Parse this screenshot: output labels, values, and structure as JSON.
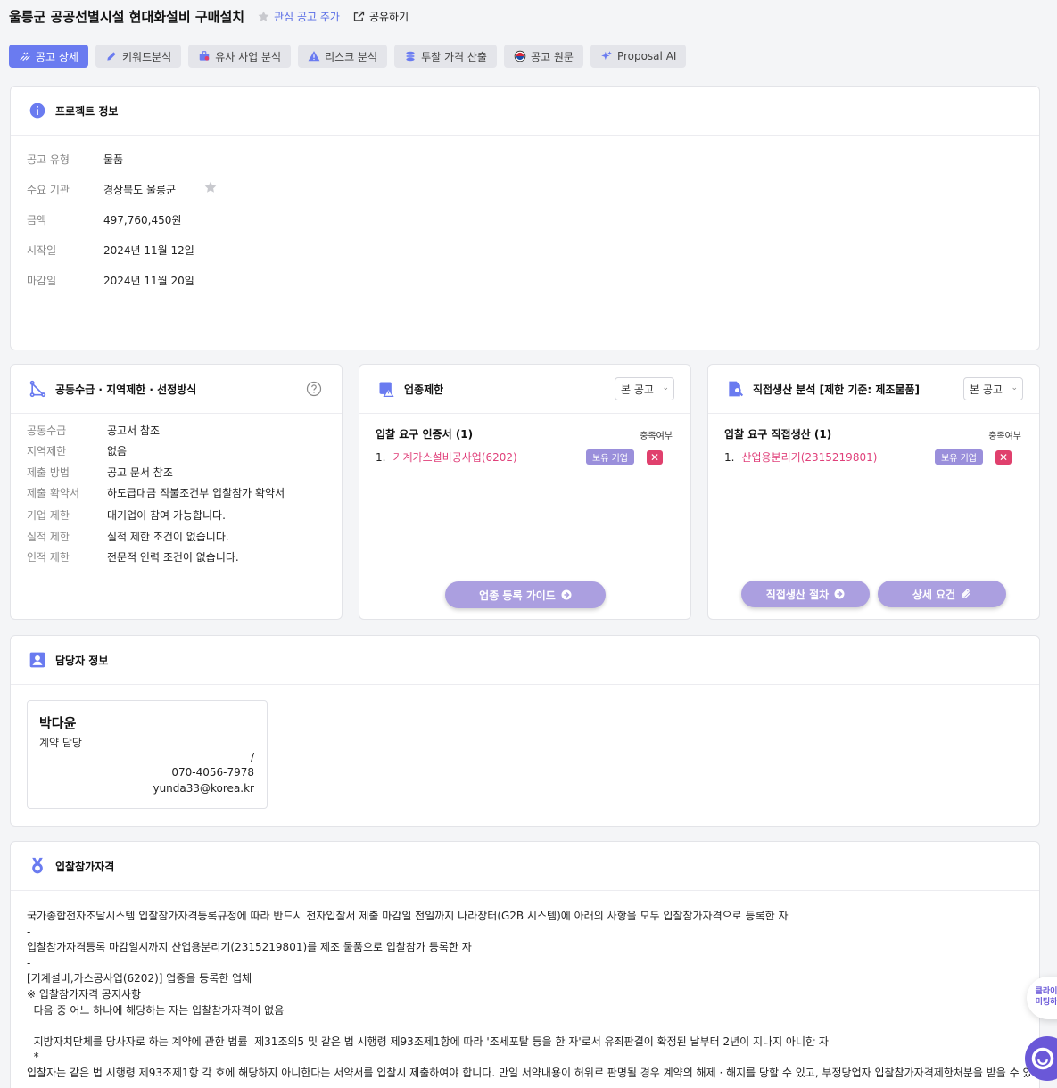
{
  "title": "울릉군 공공선별시설 현대화설비 구매설치",
  "favorite_label": "관심 공고 추가",
  "share_label": "공유하기",
  "tabs": [
    {
      "label": "공고 상세",
      "active": true
    },
    {
      "label": "키워드분석"
    },
    {
      "label": "유사 사업 분석"
    },
    {
      "label": "리스크 분석"
    },
    {
      "label": "투찰 가격 산출"
    },
    {
      "label": "공고 원문"
    },
    {
      "label": "Proposal AI"
    }
  ],
  "project": {
    "title": "프로젝트 정보",
    "rows": [
      {
        "key": "공고 유형",
        "value": "물품"
      },
      {
        "key": "수요 기관",
        "value": "경상북도 울릉군"
      },
      {
        "key": "금액",
        "value": "497,760,450원"
      },
      {
        "key": "시작일",
        "value": "2024년 11월 12일"
      },
      {
        "key": "마감일",
        "value": "2024년 11월 20일"
      }
    ]
  },
  "joint": {
    "title": "공동수급 · 지역제한 · 선정방식",
    "rows": [
      {
        "key": "공동수급",
        "value": "공고서 참조"
      },
      {
        "key": "지역제한",
        "value": "없음"
      },
      {
        "key": "제출 방법",
        "value": "공고 문서 참조"
      },
      {
        "key": "제출 확약서",
        "value": "하도급대금 직불조건부 입찰참가 확약서"
      },
      {
        "key": "기업 제한",
        "value": "대기업이 참여 가능합니다."
      },
      {
        "key": "실적 제한",
        "value": "실적 제한 조건이 없습니다."
      },
      {
        "key": "인적 제한",
        "value": "전문적 인력 조건이 없습니다."
      }
    ]
  },
  "industry": {
    "title": "업종제한",
    "select": "본 공고",
    "req_heading": "입찰 요구 인증서 (1)",
    "status_label": "충족여부",
    "item_num": "1.",
    "item_name": "기계가스설비공사업(6202)",
    "badge": "보유 기업",
    "guide_button": "업종 등록 가이드"
  },
  "direct": {
    "title": "직접생산 분석 [제한 기준: 제조물품]",
    "select": "본 공고",
    "req_heading": "입찰 요구 직접생산 (1)",
    "status_label": "충족여부",
    "item_num": "1.",
    "item_name": "산업용분리기(2315219801)",
    "badge": "보유 기업",
    "procedure_button": "직접생산 절차",
    "detail_button": "상세 요건"
  },
  "contact": {
    "title": "담당자 정보",
    "name": "박다윤",
    "role": "계약 담당",
    "sep": "/",
    "phone": "070-4056-7978",
    "email": "yunda33@korea.kr"
  },
  "qualification": {
    "title": "입찰참가자격",
    "lines": [
      "국가종합전자조달시스템 입찰참가자격등록규정에 따라 반드시 전자입찰서 제출 마감일 전일까지 나라장터(G2B 시스템)에 아래의 사항을 모두 입찰참가자격으로 등록한 자",
      "-",
      "입찰참가자격등록 마감일시까지 산업용분리기(2315219801)를 제조 물품으로 입찰참가 등록한 자",
      "-",
      "[기계설비,가스공사업(6202)] 업종을 등록한 업체",
      "※ 입찰참가자격 공지사항",
      "  다음 중 어느 하나에 해당하는 자는 입찰참가자격이 없음",
      " -",
      "  지방자치단체를 당사자로 하는 계약에 관한 법률  제31조의5 및 같은 법 시행령 제93조제1항에 따라 '조세포탈 등을 한 자'로서 유죄판결이 확정된 날부터 2년이 지나지 아니한 자",
      "  *",
      "입찰자는 같은 법 시행령 제93조제1항 각 호에 해당하지 아니한다는 서약서를 입찰시 제출하여야 합니다. 만일 서약내용이 허위로 판명될 경우 계약의 해제 · 해지를 당할 수 있고, 부정당업자 입찰참가자격제한처분을 받을 수 있습니"
    ]
  },
  "floating": {
    "meeting_label_1": "클라이",
    "meeting_label_2": "미팅하"
  },
  "colors": {
    "accent": "#6a7bf0",
    "pill": "#ab9fe0",
    "badge": "#9a8fdb",
    "danger": "#e0406d",
    "link_pink": "#e0407a"
  }
}
